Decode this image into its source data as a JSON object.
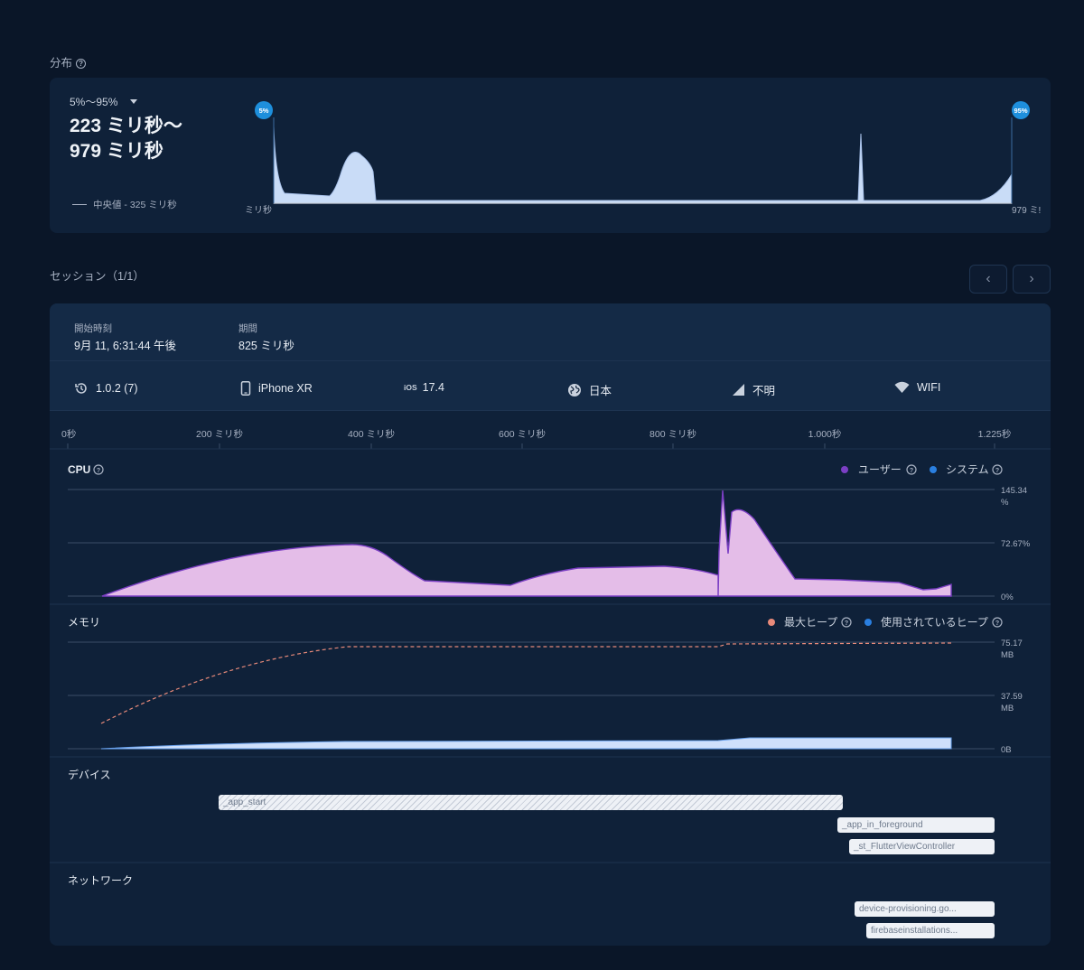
{
  "distribution": {
    "title": "分布",
    "range_select": "5%〜95%",
    "range_line1": "223 ミリ秒〜",
    "range_line2": "979 ミリ秒",
    "median": "中央値 - 325 ミリ秒",
    "marker_left": "5%",
    "marker_right": "95%",
    "axis_left": "ミリ秒",
    "axis_right": "979 ミ!"
  },
  "session": {
    "title": "セッション（1/1）",
    "prev_icon": "chevron-left-icon",
    "next_icon": "chevron-right-icon",
    "start_label": "開始時刻",
    "start_value": "9月 11, 6:31:44 午後",
    "duration_label": "期間",
    "duration_value": "825 ミリ秒",
    "app_version": "1.0.2 (7)",
    "device": "iPhone XR",
    "os_label": "iOS",
    "os_version": "17.4",
    "country": "日本",
    "carrier": "不明",
    "network": "WIFI"
  },
  "timeline": {
    "ticks": [
      "0秒",
      "200 ミリ秒",
      "400 ミリ秒",
      "600 ミリ秒",
      "800 ミリ秒",
      "1.000秒",
      "1.225秒"
    ]
  },
  "cpu": {
    "title": "CPU",
    "legend_user": "ユーザー",
    "legend_system": "システム",
    "y_max": "145.34",
    "y_unit": "%",
    "y_mid": "72.67%",
    "y_min": "0%"
  },
  "memory": {
    "title": "メモリ",
    "legend_max": "最大ヒープ",
    "legend_used": "使用されているヒープ",
    "y_max": "75.17",
    "y_max_unit": "MB",
    "y_mid": "37.59",
    "y_mid_unit": "MB",
    "y_min": "0B"
  },
  "device_traces": {
    "title": "デバイス",
    "items": [
      "_app_start",
      "_app_in_foreground",
      "_st_FlutterViewController"
    ]
  },
  "network_traces": {
    "title": "ネットワーク",
    "items": [
      "device-provisioning.go...",
      "firebaseinstallations..."
    ]
  },
  "colors": {
    "background": "#0a1628",
    "card": "#0f2139",
    "cpu_user": "#7b3fc4",
    "cpu_system": "#2a7fe0",
    "heap_max": "#e88a7a",
    "heap_used": "#2a7fe0",
    "marker": "#1e8fdc"
  }
}
